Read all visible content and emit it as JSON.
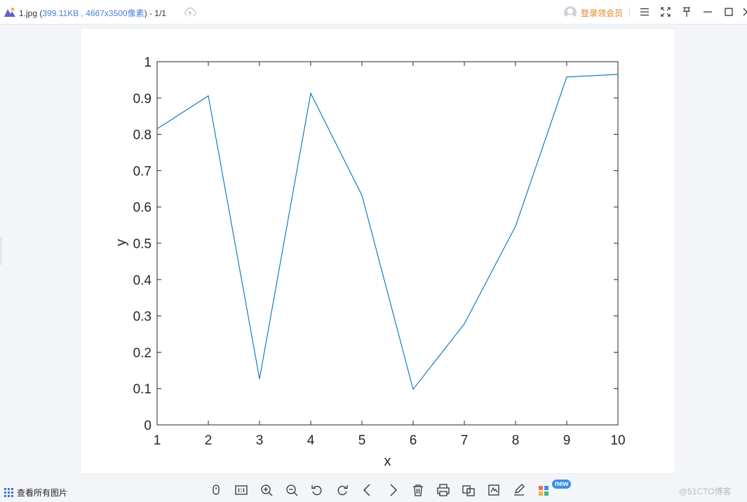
{
  "window": {
    "file_name": "1.jpg",
    "file_meta": "399.11KB , 4667x3500像素",
    "page_counter": "1/1",
    "login_label": "登录领会员",
    "icons": [
      "app-logo-icon",
      "cloud-upload-icon",
      "avatar-icon",
      "menu-icon",
      "fullscreen-icon",
      "pin-icon",
      "minimize-icon",
      "maximize-icon",
      "close-icon"
    ]
  },
  "toolbar": {
    "view_all_label": "查看所有图片",
    "new_badge": "new",
    "tools": [
      "mouse-icon",
      "actual-size-icon",
      "zoom-in-icon",
      "zoom-out-icon",
      "rotate-left-icon",
      "rotate-right-icon",
      "previous-icon",
      "next-icon",
      "delete-icon",
      "print-icon",
      "compare-icon",
      "convert-icon",
      "edit-icon",
      "apps-icon"
    ]
  },
  "watermark": "@51CTO博客",
  "chart_data": {
    "type": "line",
    "title": "",
    "xlabel": "x",
    "ylabel": "y",
    "xlim": [
      1,
      10
    ],
    "ylim": [
      0,
      1
    ],
    "x_ticks": [
      "1",
      "2",
      "3",
      "4",
      "5",
      "6",
      "7",
      "8",
      "9",
      "10"
    ],
    "y_ticks": [
      "0",
      "0.1",
      "0.2",
      "0.3",
      "0.4",
      "0.5",
      "0.6",
      "0.7",
      "0.8",
      "0.9",
      "1"
    ],
    "grid": false,
    "legend": "none",
    "series": [
      {
        "color": "#0072bd",
        "x": [
          1,
          2,
          3,
          4,
          5,
          6,
          7,
          8,
          9,
          10
        ],
        "y": [
          0.815,
          0.906,
          0.127,
          0.913,
          0.632,
          0.098,
          0.278,
          0.547,
          0.958,
          0.965
        ]
      }
    ]
  }
}
